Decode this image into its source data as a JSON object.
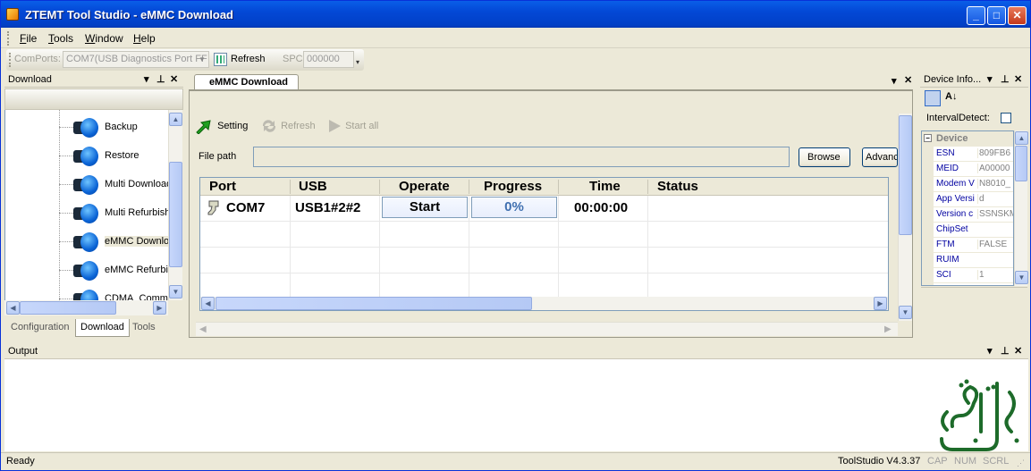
{
  "window": {
    "title": "ZTEMT Tool Studio - eMMC Download",
    "controls": {
      "minimize": "_",
      "maximize": "□",
      "close": "✕"
    }
  },
  "menu": [
    "File",
    "Tools",
    "Window",
    "Help"
  ],
  "toolbar": {
    "comports_label": "ComPorts:",
    "comport_value": "COM7(USB Diagnostics Port FF",
    "refresh_label": "Refresh",
    "spc_label": "SPC",
    "spc_value": "000000"
  },
  "left_panel": {
    "title": "Download",
    "items": [
      {
        "label": "Backup"
      },
      {
        "label": "Restore"
      },
      {
        "label": "Multi Download"
      },
      {
        "label": "Multi Refurbish"
      },
      {
        "label": "eMMC Download"
      },
      {
        "label": "eMMC Refurbish"
      },
      {
        "label": "CDMA_Commo"
      }
    ],
    "selected_index": 4,
    "tabs": [
      "Configuration",
      "Download",
      "Tools"
    ],
    "active_tab": "Download"
  },
  "document": {
    "tab_title": "eMMC Download",
    "actions": {
      "setting": "Setting",
      "refresh": "Refresh",
      "start_all": "Start all"
    },
    "file_path_label": "File path",
    "file_path_value": "",
    "browse_label": "Browse",
    "advanced_label": "Advanced",
    "grid": {
      "headers": [
        "Port",
        "USB",
        "Operate",
        "Progress",
        "Time",
        "Status"
      ],
      "rows": [
        {
          "port": "COM7",
          "usb": "USB1#2#2",
          "operate": "Start",
          "progress": "0%",
          "time": "00:00:00",
          "status": ""
        }
      ]
    },
    "progress_fraction": 0
  },
  "device_info": {
    "title": "Device Info...",
    "interval_label": "IntervalDetect:",
    "interval_checked": false,
    "category": "Device",
    "properties": [
      {
        "key": "ESN",
        "value": "809FB6"
      },
      {
        "key": "MEID",
        "value": "A00000"
      },
      {
        "key": "Modem V",
        "value": "N8010_"
      },
      {
        "key": "App Versi",
        "value": "d"
      },
      {
        "key": "Version c",
        "value": "SSNSKM"
      },
      {
        "key": "ChipSet",
        "value": ""
      },
      {
        "key": "FTM",
        "value": "FALSE"
      },
      {
        "key": "RUIM",
        "value": ""
      },
      {
        "key": "SCI",
        "value": "1"
      }
    ]
  },
  "output": {
    "title": "Output"
  },
  "statusbar": {
    "ready": "Ready",
    "version": "ToolStudio V4.3.37",
    "cap": "CAP",
    "num": "NUM",
    "scrl": "SCRL"
  },
  "colors": {
    "title_blue": "#0348d6",
    "accent_green": "#18a018",
    "progress_blue": "#4070b0"
  }
}
